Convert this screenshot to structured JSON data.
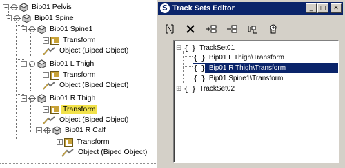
{
  "tree": {
    "nodes": [
      {
        "label": "Bip01 Pelvis"
      },
      {
        "label": "Bip01 Spine"
      },
      {
        "label": "Bip01 Spine1"
      },
      {
        "label": "Transform"
      },
      {
        "label": "Object (Biped Object)"
      },
      {
        "label": "Bip01 L Thigh"
      },
      {
        "label": "Transform"
      },
      {
        "label": "Object (Biped Object)"
      },
      {
        "label": "Bip01 R Thigh"
      },
      {
        "label": "Transform",
        "highlighted": true
      },
      {
        "label": "Object (Biped Object)"
      },
      {
        "label": "Bip01 R Calf"
      },
      {
        "label": "Transform"
      },
      {
        "label": "Object (Biped Object)"
      }
    ]
  },
  "window": {
    "title": "Track Sets Editor",
    "app_icon": "S",
    "controls": {
      "minimize": "_",
      "maximize": "□",
      "close": "✕"
    },
    "toolbar": [
      {
        "icon": "select-tracks-icon"
      },
      {
        "icon": "delete-icon"
      },
      {
        "icon": "add-tracks-icon"
      },
      {
        "icon": "remove-tracks-icon"
      },
      {
        "icon": "highlight-tracks-icon"
      },
      {
        "icon": "get-selected-icon"
      }
    ],
    "tracksets": [
      {
        "toggle": "⊟",
        "brace": "{ }",
        "label": "TrackSet01"
      },
      {
        "brace": "{ }",
        "label": "Bip01 L Thigh\\Transform"
      },
      {
        "brace": "{ }",
        "label": "Bip01 R Thigh\\Transform",
        "selected": true
      },
      {
        "brace": "{ }",
        "label": "Bip01 Spine1\\Transform"
      },
      {
        "toggle": "⊞",
        "brace": "{ }",
        "label": "TrackSet02"
      }
    ]
  },
  "colors": {
    "titlebar": "#0a246a",
    "selection": "#0a246a",
    "highlight": "#f2e24a",
    "window_face": "#d4d0c8"
  }
}
